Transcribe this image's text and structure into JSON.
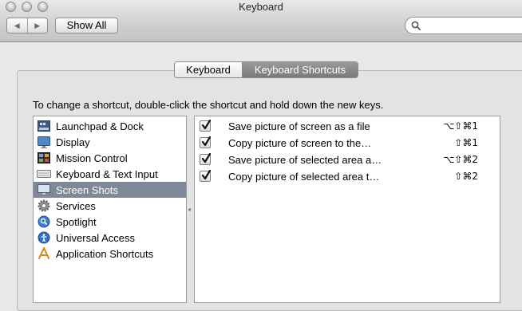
{
  "window": {
    "title": "Keyboard"
  },
  "toolbar": {
    "back_symbol": "◀",
    "forward_symbol": "▶",
    "show_all_label": "Show All",
    "search_value": ""
  },
  "tabs": [
    {
      "label": "Keyboard",
      "selected": false
    },
    {
      "label": "Keyboard Shortcuts",
      "selected": true
    }
  ],
  "instruction": "To change a shortcut, double-click the shortcut and hold down the new keys.",
  "categories": [
    {
      "label": "Launchpad & Dock",
      "icon": "launchpad-dock-icon"
    },
    {
      "label": "Display",
      "icon": "display-icon"
    },
    {
      "label": "Mission Control",
      "icon": "mission-control-icon"
    },
    {
      "label": "Keyboard & Text Input",
      "icon": "keyboard-icon"
    },
    {
      "label": "Screen Shots",
      "icon": "screen-shots-icon",
      "selected": true
    },
    {
      "label": "Services",
      "icon": "gear-icon"
    },
    {
      "label": "Spotlight",
      "icon": "spotlight-icon"
    },
    {
      "label": "Universal Access",
      "icon": "universal-access-icon"
    },
    {
      "label": "Application Shortcuts",
      "icon": "app-store-icon"
    }
  ],
  "shortcuts": [
    {
      "checked": true,
      "name": "Save picture of screen as a file",
      "keys": "⌥⇧⌘1"
    },
    {
      "checked": true,
      "name": "Copy picture of screen to the…",
      "keys": "⇧⌘1"
    },
    {
      "checked": true,
      "name": "Save picture of selected area a…",
      "keys": "⌥⇧⌘2"
    },
    {
      "checked": true,
      "name": "Copy picture of selected area t…",
      "keys": "⇧⌘2"
    }
  ],
  "colors": {
    "selection": "#7f8897",
    "tab_selected": "#858585"
  }
}
